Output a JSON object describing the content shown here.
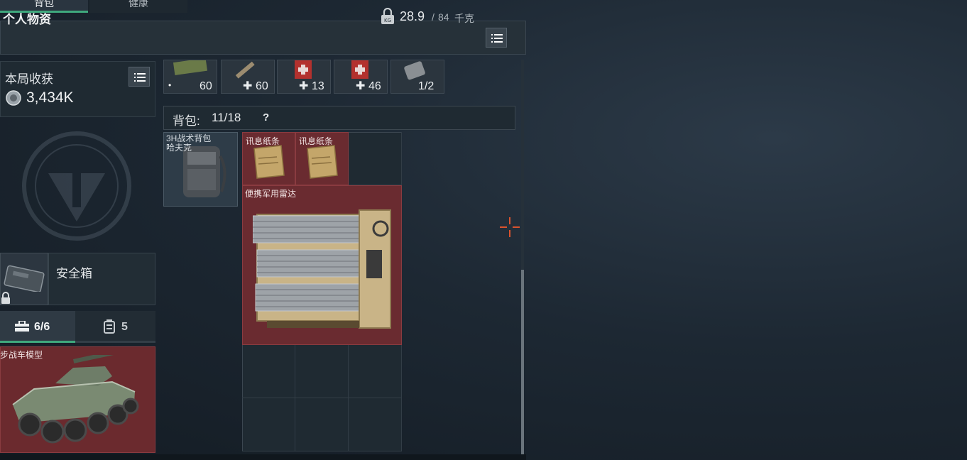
{
  "tabs": [
    {
      "label": "背包",
      "active": true
    },
    {
      "label": "健康",
      "active": false
    }
  ],
  "header": {
    "title": "个人物资",
    "weight_current": "28.9",
    "weight_separator": "/",
    "weight_max": "84",
    "weight_unit": "千克",
    "icons": [
      "lock-weight-icon",
      "list-menu-icon"
    ]
  },
  "earnings": {
    "label": "本局收获",
    "value": "3,434K",
    "icons": [
      "coin-icon",
      "list-menu-icon"
    ]
  },
  "safebox": {
    "label": "安全箱",
    "icons": [
      "lock-icon"
    ]
  },
  "pouch_tabs": [
    {
      "count": "6/6",
      "icon": "toolbox-icon",
      "active": true
    },
    {
      "count": "5",
      "icon": "canister-icon",
      "active": false
    }
  ],
  "pocket_item": {
    "label": "步战车模型"
  },
  "quick_slots": [
    {
      "prefix": "•",
      "count": "60",
      "icon": "ammo-box-icon"
    },
    {
      "prefix": "✚",
      "count": "60",
      "icon": "syringe-icon"
    },
    {
      "prefix": "✚",
      "count": "13",
      "icon": "medkit-icon"
    },
    {
      "prefix": "✚",
      "count": "46",
      "icon": "medkit-icon"
    },
    {
      "prefix": "",
      "count": "1/2",
      "icon": "armor-plate-icon"
    }
  ],
  "backpack": {
    "label": "背包:",
    "capacity": "11/18",
    "help": "?",
    "equipped": {
      "name_line1": "3H战术背包",
      "name_line2": "哈夫克"
    }
  },
  "items": [
    {
      "label": "讯息纸条"
    },
    {
      "label": "讯息纸条"
    },
    {
      "label": "便携军用雷达"
    }
  ],
  "colors": {
    "accent_green": "#3fa87d",
    "rare_red": "#6a2b30",
    "panel": "#1f2a32"
  }
}
